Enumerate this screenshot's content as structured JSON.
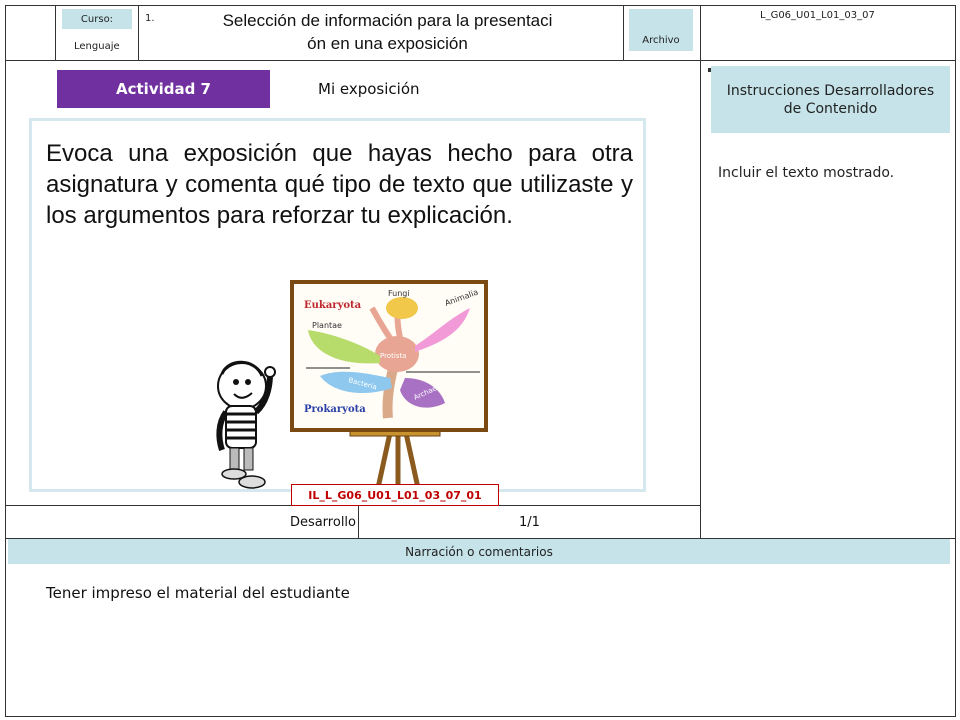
{
  "header": {
    "curso_label": "Curso:",
    "curso_value": "Lenguaje",
    "number": "1.",
    "title_line1": "Selección de información para la presentaci",
    "title_line2": "ón en una exposición",
    "archivo_label": "Archivo",
    "file_code": "L_G06_U01_L01_03_07"
  },
  "activity": {
    "badge": "Actividad 7",
    "subtitle": "Mi exposición",
    "body": "Evoca una exposición que hayas hecho para otra asignatura y comenta qué tipo de texto que utilizaste y los argumentos para reforzar tu explicación.",
    "image_code": "IL_L_G06_U01_L01_03_07_01"
  },
  "illustration": {
    "eukaryota": "Eukaryota",
    "prokaryota": "Prokaryota",
    "fungi": "Fungi",
    "animalia": "Animalia",
    "plantae": "Plantae",
    "protista": "Protista",
    "bacteria": "Bacteria",
    "archaea": "Archaea"
  },
  "instructions": {
    "header": "Instrucciones Desarrolladores de Contenido",
    "text": "Incluir el texto mostrado."
  },
  "footer": {
    "section": "Desarrollo",
    "page": "1/1"
  },
  "narration": {
    "header": "Narración o comentarios",
    "text": "Tener impreso el material del estudiante"
  }
}
